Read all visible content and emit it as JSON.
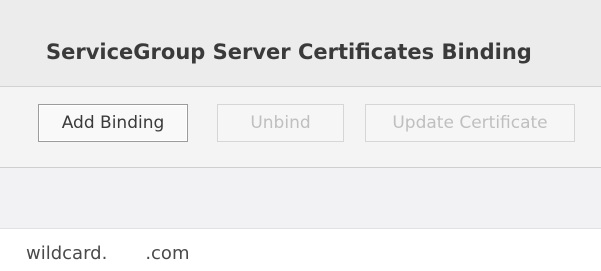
{
  "panel": {
    "title": "ServiceGroup Server Certificates Binding"
  },
  "toolbar": {
    "add_binding_label": "Add Binding",
    "unbind_label": "Unbind",
    "update_certificate_label": "Update Certificate"
  },
  "table": {
    "rows": [
      {
        "name_part1": "wildcard.",
        "name_part2": ".com"
      }
    ]
  }
}
